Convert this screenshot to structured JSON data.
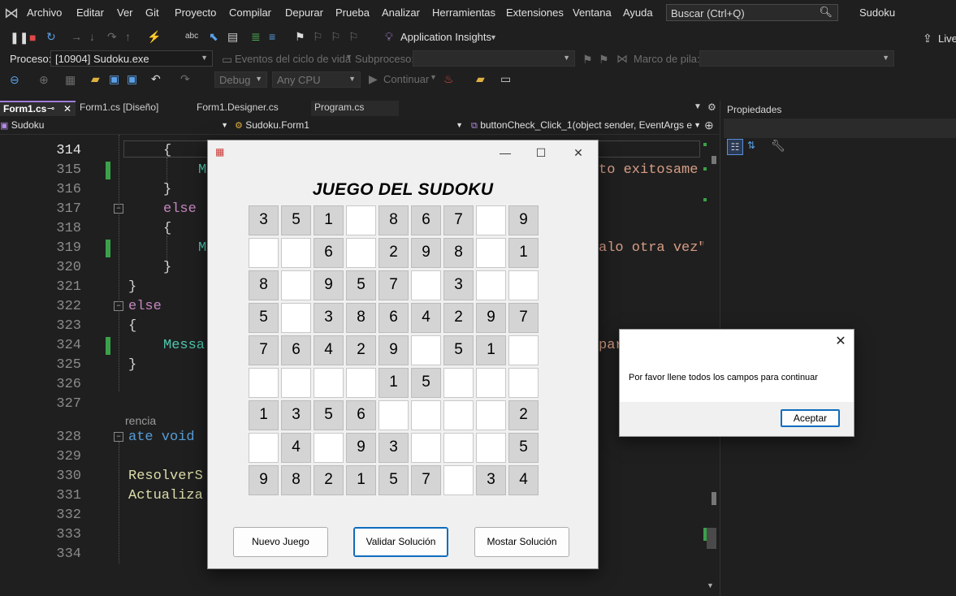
{
  "menubar": {
    "items": [
      "Archivo",
      "Editar",
      "Ver",
      "Git",
      "Proyecto",
      "Compilar",
      "Depurar",
      "Prueba",
      "Analizar",
      "Herramientas",
      "Extensiones",
      "Ventana",
      "Ayuda"
    ],
    "search_placeholder": "Buscar (Ctrl+Q)",
    "app_name": "Sudoku",
    "live_share": "Live"
  },
  "toolbar1": {
    "app_insights": "Application Insights"
  },
  "toolbar2": {
    "process_label": "Proceso:",
    "process_value": "[10904] Sudoku.exe",
    "lifecycle": "Eventos del ciclo de vida",
    "subprocess_label": "Subproceso:",
    "stack_label": "Marco de pila:"
  },
  "toolbar3": {
    "config": "Debug",
    "platform": "Any CPU",
    "continue": "Continuar"
  },
  "tabs": [
    {
      "label": "Form1.cs"
    },
    {
      "label": "Form1.cs [Diseño]"
    },
    {
      "label": "Form1.Designer.cs"
    },
    {
      "label": "Program.cs"
    }
  ],
  "navbar": {
    "project": "Sudoku",
    "class": "Sudoku.Form1",
    "member": "buttonCheck_Click_1(object sender, EventArgs e"
  },
  "editor": {
    "line_numbers": [
      "314",
      "315",
      "316",
      "317",
      "318",
      "319",
      "320",
      "321",
      "322",
      "323",
      "324",
      "325",
      "326",
      "327",
      "328",
      "329",
      "330",
      "331",
      "332",
      "333",
      "334"
    ],
    "codelens": "rencia"
  },
  "properties": {
    "title": "Propiedades"
  },
  "sudoku_form": {
    "title": "JUEGO DEL SUDOKU",
    "grid": [
      [
        "3",
        "5",
        "1",
        "",
        "8",
        "6",
        "7",
        "",
        "9"
      ],
      [
        "",
        "",
        "6",
        "",
        "2",
        "9",
        "8",
        "",
        "1"
      ],
      [
        "8",
        "",
        "9",
        "5",
        "7",
        "",
        "3",
        "",
        ""
      ],
      [
        "5",
        "",
        "3",
        "8",
        "6",
        "4",
        "2",
        "9",
        "7"
      ],
      [
        "7",
        "6",
        "4",
        "2",
        "9",
        "",
        "5",
        "1",
        ""
      ],
      [
        "",
        "",
        "",
        "",
        "1",
        "5",
        "",
        "",
        ""
      ],
      [
        "1",
        "3",
        "5",
        "6",
        "",
        "",
        "",
        "",
        "2"
      ],
      [
        "",
        "4",
        "",
        "9",
        "3",
        "",
        "",
        "",
        "5"
      ],
      [
        "9",
        "8",
        "2",
        "1",
        "5",
        "7",
        "",
        "3",
        "4"
      ]
    ],
    "new_game_button": "Nuevo Juego",
    "validate_button": "Validar Solución",
    "show_solution_button": "Mostar Solución"
  },
  "message_box": {
    "text": "Por favor llene todos los campos para continuar",
    "ok_button": "Aceptar"
  }
}
